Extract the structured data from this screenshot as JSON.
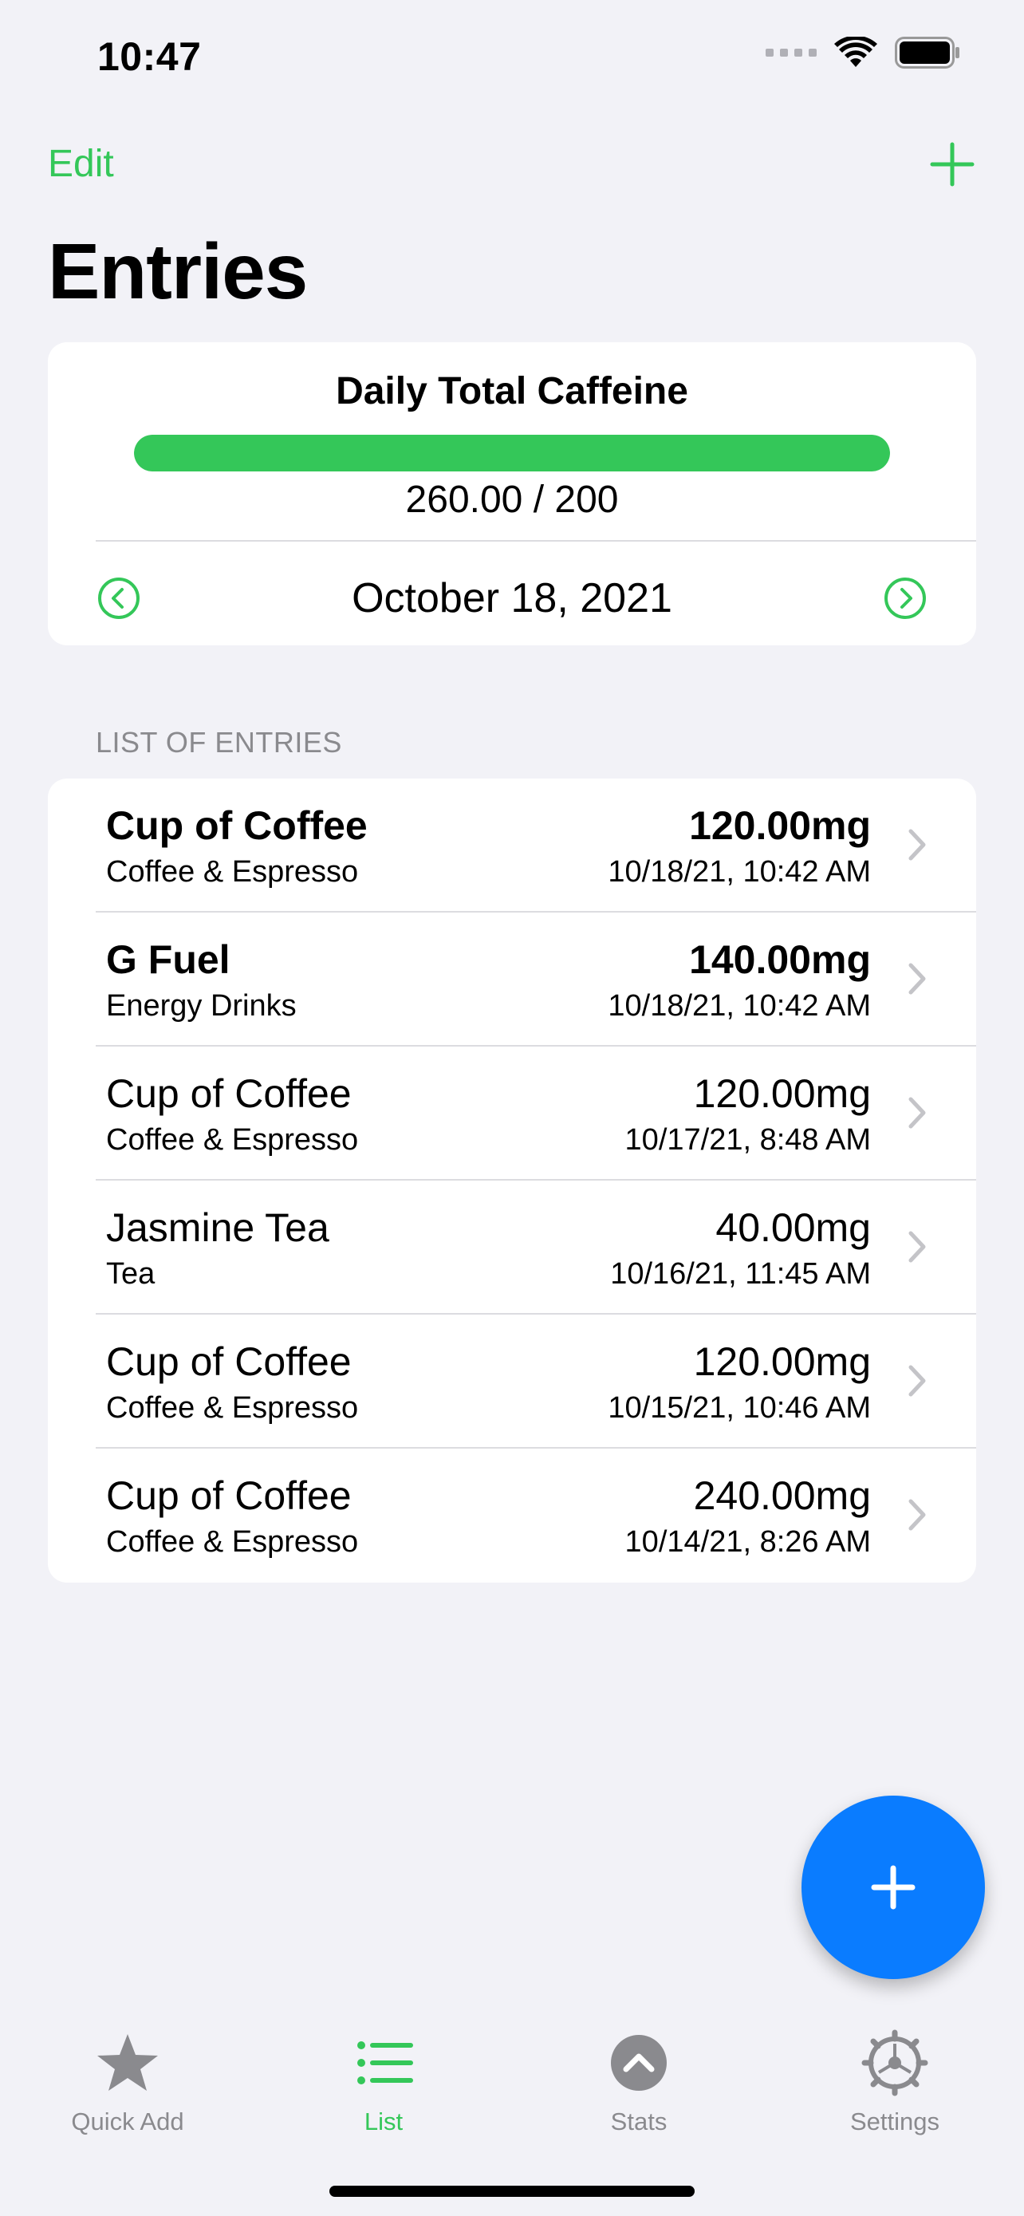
{
  "status_bar": {
    "time": "10:47",
    "icons": [
      "cellular-signal-icon",
      "wifi-icon",
      "battery-icon"
    ]
  },
  "nav": {
    "edit_label": "Edit",
    "add_icon": "plus-icon",
    "title": "Entries"
  },
  "summary": {
    "title": "Daily Total Caffeine",
    "progress_text": "260.00 / 200",
    "progress_fraction": 1.0,
    "date": "October 18, 2021",
    "prev_icon": "chevron-left-circle-icon",
    "next_icon": "chevron-right-circle-icon"
  },
  "list": {
    "header": "LIST OF ENTRIES",
    "entries": [
      {
        "name": "Cup of Coffee",
        "category": "Coffee & Espresso",
        "amount": "120.00mg",
        "time": "10/18/21, 10:42 AM",
        "bold": true
      },
      {
        "name": "G Fuel",
        "category": "Energy Drinks",
        "amount": "140.00mg",
        "time": "10/18/21, 10:42 AM",
        "bold": true
      },
      {
        "name": "Cup of Coffee",
        "category": "Coffee & Espresso",
        "amount": "120.00mg",
        "time": "10/17/21, 8:48 AM",
        "bold": false
      },
      {
        "name": "Jasmine Tea",
        "category": "Tea",
        "amount": "40.00mg",
        "time": "10/16/21, 11:45 AM",
        "bold": false
      },
      {
        "name": "Cup of Coffee",
        "category": "Coffee & Espresso",
        "amount": "120.00mg",
        "time": "10/15/21, 10:46 AM",
        "bold": false
      },
      {
        "name": "Cup of Coffee",
        "category": "Coffee & Espresso",
        "amount": "240.00mg",
        "time": "10/14/21, 8:26 AM",
        "bold": false
      }
    ]
  },
  "fab": {
    "icon": "plus-icon"
  },
  "tabs": [
    {
      "label": "Quick Add",
      "icon": "star-icon",
      "active": false
    },
    {
      "label": "List",
      "icon": "list-icon",
      "active": true
    },
    {
      "label": "Stats",
      "icon": "chevron-up-circle-icon",
      "active": false
    },
    {
      "label": "Settings",
      "icon": "gear-icon",
      "active": false
    }
  ],
  "colors": {
    "accent": "#34c759",
    "fab": "#0a7cff",
    "background": "#f2f2f7",
    "secondary_text": "#8a8a8e"
  }
}
